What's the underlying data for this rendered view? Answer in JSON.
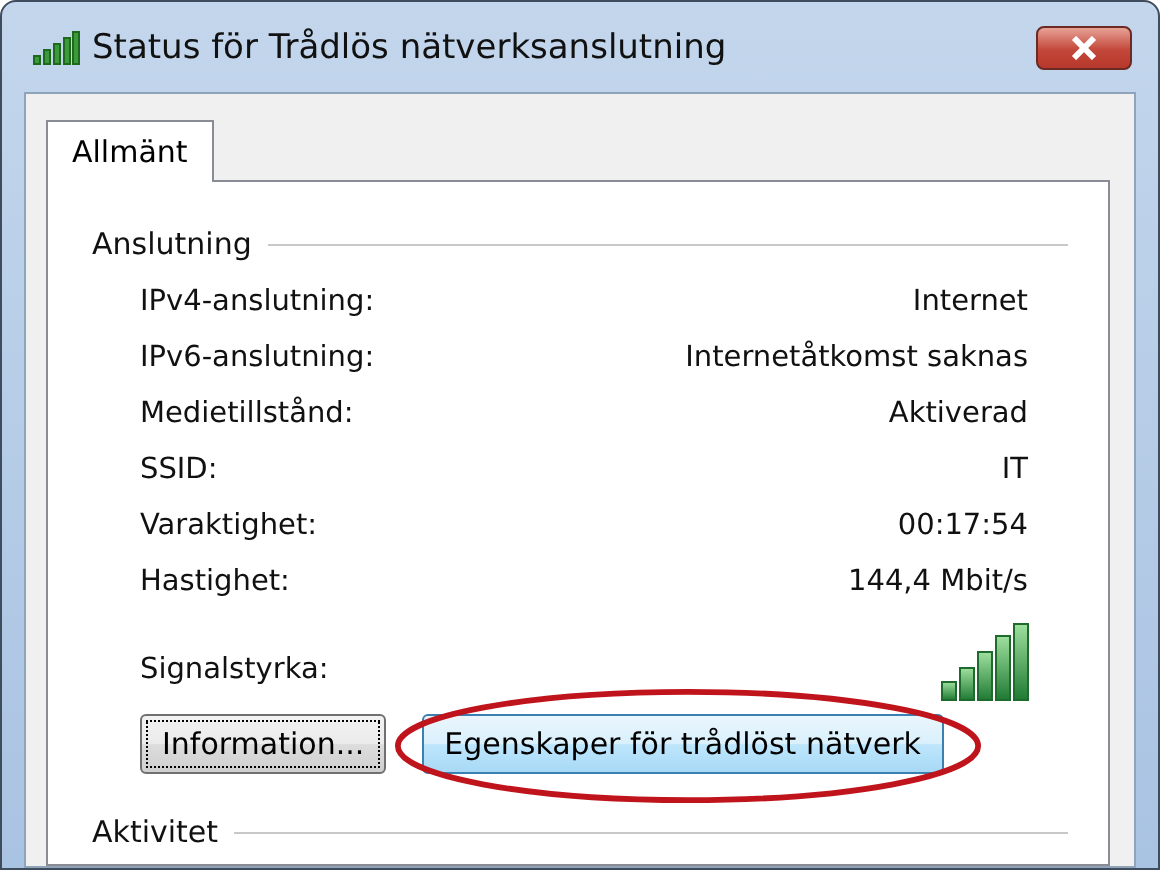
{
  "window": {
    "title": "Status för Trådlös nätverksanslutning"
  },
  "tabs": [
    {
      "label": "Allmänt",
      "selected": true
    }
  ],
  "connection": {
    "heading": "Anslutning",
    "rows": [
      {
        "label": "IPv4-anslutning:",
        "value": "Internet"
      },
      {
        "label": "IPv6-anslutning:",
        "value": "Internetåtkomst saknas"
      },
      {
        "label": "Medietillstånd:",
        "value": "Aktiverad"
      },
      {
        "label": "SSID:",
        "value": "IT"
      },
      {
        "label": "Varaktighet:",
        "value": "00:17:54"
      },
      {
        "label": "Hastighet:",
        "value": "144,4 Mbit/s"
      }
    ],
    "signal_label": "Signalstyrka:",
    "buttons": [
      {
        "label": "Information...",
        "focused": true,
        "highlighted": false,
        "circled": false
      },
      {
        "label": "Egenskaper för trådlöst nätverk",
        "focused": false,
        "highlighted": true,
        "circled": true
      }
    ]
  },
  "activity": {
    "heading": "Aktivitet"
  }
}
